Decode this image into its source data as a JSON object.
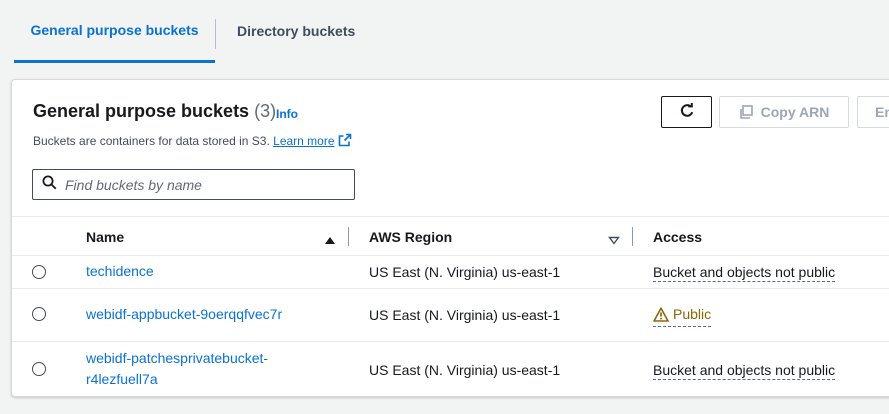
{
  "tabs": [
    {
      "label": "General purpose buckets",
      "active": true
    },
    {
      "label": "Directory buckets",
      "active": false
    }
  ],
  "panel": {
    "title": "General purpose buckets",
    "count": "(3)",
    "info": "Info",
    "description": "Buckets are containers for data stored in S3.",
    "learn_more": "Learn more"
  },
  "toolbar": {
    "refresh_icon": "refresh-icon",
    "copy_arn_label": "Copy ARN",
    "empty_label": "Empty"
  },
  "search": {
    "placeholder": "Find buckets by name",
    "value": ""
  },
  "table": {
    "columns": [
      {
        "label": "Name",
        "sort": "ascending"
      },
      {
        "label": "AWS Region",
        "sort": "sortable"
      },
      {
        "label": "Access"
      }
    ],
    "rows": [
      {
        "name": "techidence",
        "name_line2": "",
        "region": "US East (N. Virginia) us-east-1",
        "access": "Bucket and objects not public",
        "access_status": "not-public",
        "selected": false
      },
      {
        "name": "webidf-appbucket-9oerqqfvec7r",
        "name_line2": "",
        "region": "US East (N. Virginia) us-east-1",
        "access": "Public",
        "access_status": "public",
        "selected": false
      },
      {
        "name": "webidf-patchesprivatebucket-",
        "name_line2": "r4lezfuell7a",
        "region": "US East (N. Virginia) us-east-1",
        "access": "Bucket and objects not public",
        "access_status": "not-public",
        "selected": false
      }
    ]
  },
  "colors": {
    "accent": "#0972d3",
    "warning": "#8d6605",
    "text": "#16191f"
  }
}
